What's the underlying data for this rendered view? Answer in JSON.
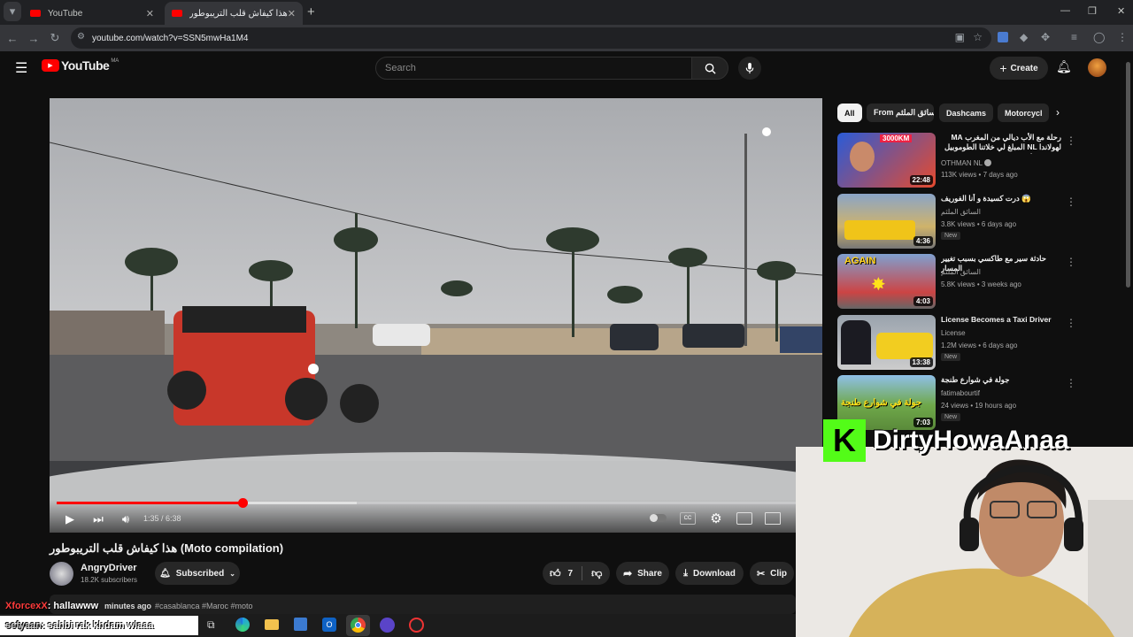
{
  "browser": {
    "tabs": [
      {
        "title": "YouTube"
      },
      {
        "title": "هذا كيفاش قلب التريبوطور (Moto compilation)"
      }
    ],
    "new_tab": "+",
    "url": "youtube.com/watch?v=SSN5mwHa1M4"
  },
  "youtube": {
    "logo_text": "YouTube",
    "region": "MA",
    "search_placeholder": "Search",
    "create_label": "Create"
  },
  "player": {
    "time": "1:35 / 6:38",
    "progress_fraction": 0.245,
    "buffered_fraction": 0.395
  },
  "video": {
    "title": "هذا كيفاش قلب التريبوطور (Moto compilation)",
    "channel": "AngryDriver",
    "subscribers": "18.2K subscribers",
    "subscribed_label": "Subscribed",
    "likes": "7",
    "share_label": "Share",
    "download_label": "Download",
    "clip_label": "Clip",
    "meta_tail": "minutes ago",
    "tags": "#casablanca #Maroc #moto"
  },
  "sidebar": {
    "chips": [
      "All",
      "From السائق الملثم",
      "Dashcams",
      "Motorcycl"
    ],
    "videos": [
      {
        "title": "رحلة مع الأب ديالي من المغرب MA لهولاندا NL المبلغ لي خلاتنا الطوموبيل تصرنوه ما ...",
        "channel": "OTHMAN NL",
        "meta": "113K views • 7 days ago",
        "duration": "22:48",
        "badge": "",
        "thumb_text": "3000KM"
      },
      {
        "title": "😱 درت كسيدة و أنا الفوريف",
        "channel": "السائق الملثم",
        "meta": "3.8K views • 6 days ago",
        "duration": "4:36",
        "badge": "New",
        "thumb_text": ""
      },
      {
        "title": "حادثة سير مع طاكسي بسبب تغيير المسار",
        "channel": "السائق الملثم",
        "meta": "5.8K views • 3 weeks ago",
        "duration": "4:03",
        "badge": "",
        "thumb_text": "AGAIN"
      },
      {
        "title": "License Becomes a Taxi Driver",
        "channel": "License",
        "meta": "1.2M views • 6 days ago",
        "duration": "13:38",
        "badge": "New",
        "thumb_text": ""
      },
      {
        "title": "جولة في شوارع طنجة",
        "channel": "fatimabourtif",
        "meta": "24 views • 19 hours ago",
        "duration": "7:03",
        "badge": "New",
        "thumb_text": "جولة في شوارع طنجة"
      }
    ]
  },
  "stream_overlay": {
    "streamer": "DirtyHowaAnaa",
    "chat": [
      {
        "user": "XforcexX",
        "message": ": hallawww"
      },
      {
        "user": "sefyaan",
        "message": ": sahbi rak khdam wlaaa"
      }
    ]
  },
  "colors": {
    "yt_red": "#ff0000",
    "kick_green": "#53fc18",
    "bg": "#0f0f0f"
  }
}
